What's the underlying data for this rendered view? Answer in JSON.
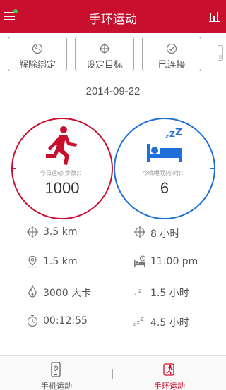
{
  "header": {
    "title": "手环运动"
  },
  "actions": {
    "unbind_label": "解除绑定",
    "set_goal_label": "设定目标",
    "connected_label": "已连接"
  },
  "date": "2014-09-22",
  "steps": {
    "caption": "今日运动(步数)：",
    "value": "1000",
    "color": "#c8102e"
  },
  "sleep": {
    "caption": "今晚睡眠(小时)：",
    "value": "6",
    "color": "#1e6fd9"
  },
  "stats": {
    "distance": "3.5 km",
    "sleep_goal": "8 小时",
    "walk_distance": "1.5 km",
    "bedtime": "11:00 pm",
    "calories": "3000 大卡",
    "light_sleep": "1.5 小时",
    "duration": "00:12:55",
    "deep_sleep": "4.5 小时"
  },
  "tabs": [
    {
      "label": "手机运动",
      "active": false
    },
    {
      "label": "手环运动",
      "active": true
    }
  ],
  "colors": {
    "brand": "#c8102e",
    "sleep": "#1e6fd9",
    "status_dot": "#3fcf4a"
  }
}
